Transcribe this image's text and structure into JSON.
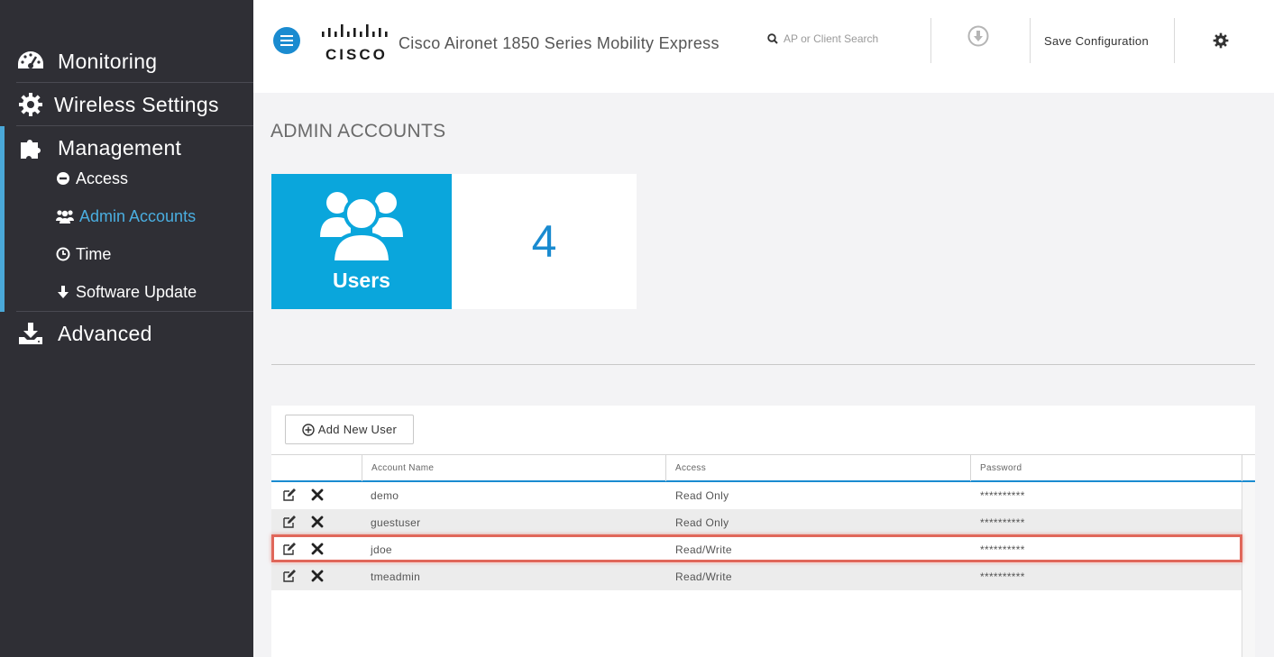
{
  "sidebar": {
    "items": [
      {
        "label": "Monitoring",
        "icon": "dashboard-icon"
      },
      {
        "label": "Wireless Settings",
        "icon": "gear-icon"
      },
      {
        "label": "Management",
        "icon": "puzzle-icon"
      },
      {
        "label": "Advanced",
        "icon": "download-tray-icon"
      }
    ],
    "management_sub": [
      {
        "label": "Access",
        "icon": "minus-circle-icon"
      },
      {
        "label": "Admin Accounts",
        "icon": "users-icon",
        "active": true
      },
      {
        "label": "Time",
        "icon": "clock-icon"
      },
      {
        "label": "Software Update",
        "icon": "arrow-down-icon"
      }
    ]
  },
  "header": {
    "brand": "CISCO",
    "product_title": "Cisco Aironet 1850 Series Mobility Express",
    "search_placeholder": "AP or Client Search",
    "save_label": "Save Configuration"
  },
  "main": {
    "page_title": "ADMIN ACCOUNTS",
    "tile": {
      "label": "Users",
      "count": "4"
    },
    "add_button_label": "Add New User",
    "table": {
      "columns": [
        "Account Name",
        "Access",
        "Password"
      ],
      "rows": [
        {
          "name": "demo",
          "access": "Read Only",
          "password": "**********"
        },
        {
          "name": "guestuser",
          "access": "Read Only",
          "password": "**********"
        },
        {
          "name": "jdoe",
          "access": "Read/Write",
          "password": "**********",
          "highlighted": true
        },
        {
          "name": "tmeadmin",
          "access": "Read/Write",
          "password": "**********"
        }
      ]
    }
  },
  "colors": {
    "sidebar_bg": "#2f2f35",
    "accent_blue": "#1a8bd0",
    "tile_blue": "#0aa6dc",
    "active_link": "#4aaee0",
    "highlight_red": "#e0675a"
  }
}
